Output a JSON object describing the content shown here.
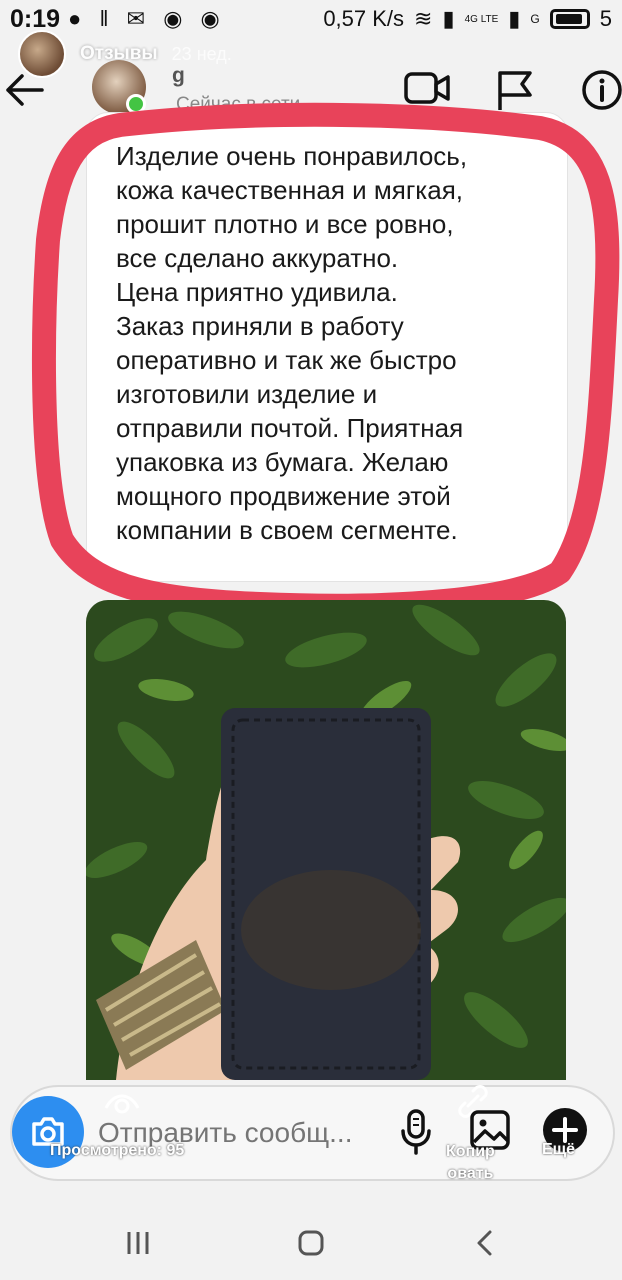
{
  "status_bar": {
    "time": "0:19",
    "speed": "0,57 K/s",
    "network1": "4G LTE",
    "network2": "G",
    "battery_text": "5"
  },
  "story_overlay": {
    "username": "Отзывы",
    "time_ago": "23 нед."
  },
  "chat_header": {
    "name": "g",
    "status": "Сейчас в сети"
  },
  "message": {
    "lines": [
      "Изделие очень понравилось,",
      "кожа качественная и мягкая,",
      "прошит плотно и все ровно,",
      "все сделано аккуратно.",
      "Цена приятно удивила.",
      "Заказ приняли в работу",
      "оперативно и так же быстро",
      "изготовили изделие и",
      "отправили почтой. Приятная",
      "упаковка из бумага. Желаю",
      "мощного продвижение этой",
      "компании в своем сегменте."
    ]
  },
  "composer": {
    "placeholder": "Отправить сообщ...",
    "views_label": "Просмотрено: 95",
    "copy_label_1": "Копир",
    "copy_label_2": "овать",
    "more_label": "Ещё"
  },
  "colors": {
    "highlight": "#e8435a",
    "camera": "#2d8ef0",
    "online": "#43c443"
  },
  "icons": [
    "back-arrow-icon",
    "video-call-icon",
    "flag-icon",
    "info-icon",
    "camera-icon",
    "microphone-icon",
    "gallery-icon",
    "plus-icon",
    "eye-icon",
    "link-icon"
  ]
}
